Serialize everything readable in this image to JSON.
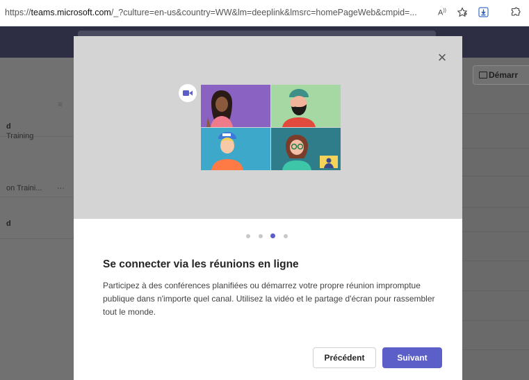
{
  "browser": {
    "url_prefix": "https://",
    "url_host": "teams.microsoft.com",
    "url_rest": "/_?culture=en-us&country=WW&lm=deeplink&lmsrc=homePageWeb&cmpid=...",
    "read_aloud_icon": "read-aloud-icon",
    "favorite_icon": "favorite-star-icon",
    "download_icon": "download-icon",
    "extensions_icon": "extensions-icon"
  },
  "background_app": {
    "left_items": [
      {
        "title": "d",
        "subtitle": "Training"
      },
      {
        "title": "",
        "subtitle": "on Traini..."
      },
      {
        "title": "d",
        "subtitle": ""
      }
    ],
    "more_label": "···",
    "meet_button_label": "Démarr"
  },
  "modal": {
    "close_label": "×",
    "pager": {
      "count": 4,
      "active_index": 2
    },
    "title": "Se connecter via les réunions en ligne",
    "description": "Participez à des conférences planifiées ou démarrez votre propre réunion impromptue publique dans n'importe quel canal. Utilisez la vidéo et le partage d'écran pour rassembler tout le monde.",
    "prev_label": "Précédent",
    "next_label": "Suivant"
  },
  "colors": {
    "accent": "#5b5fc7",
    "hero_background": "#d4d4d4"
  }
}
